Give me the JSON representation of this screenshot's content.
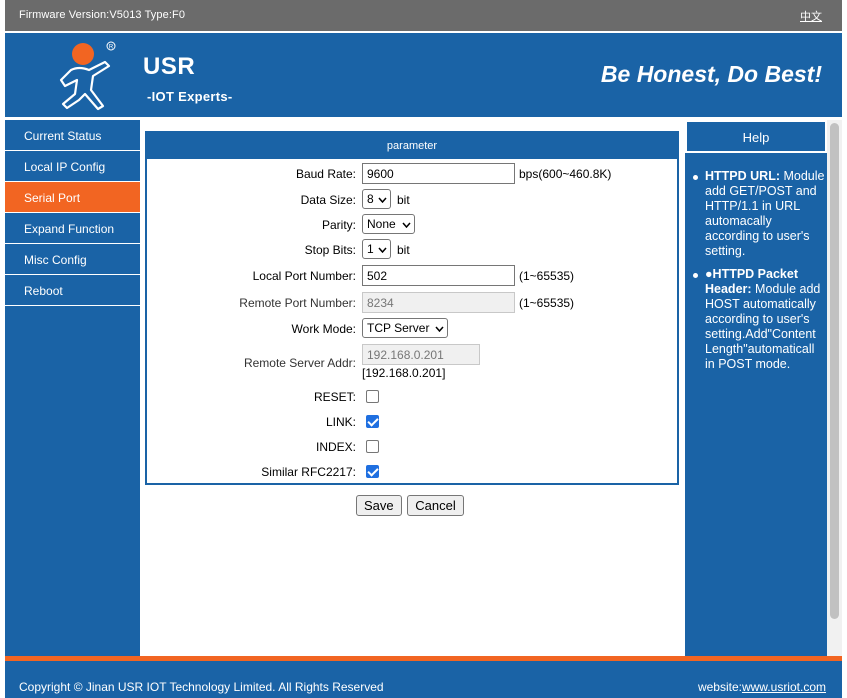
{
  "topbar": {
    "firmware": "Firmware Version:V5013 Type:F0",
    "lang_link": "中文"
  },
  "header": {
    "brand": "USR",
    "subbrand": "-IOT Experts-",
    "slogan": "Be Honest, Do Best!"
  },
  "nav": {
    "items": [
      {
        "label": "Current Status",
        "active": false
      },
      {
        "label": "Local IP Config",
        "active": false
      },
      {
        "label": "Serial Port",
        "active": true
      },
      {
        "label": "Expand Function",
        "active": false
      },
      {
        "label": "Misc Config",
        "active": false
      },
      {
        "label": "Reboot",
        "active": false
      }
    ]
  },
  "panel": {
    "title": "parameter",
    "baud_rate": {
      "label": "Baud Rate:",
      "value": "9600",
      "unit": "bps(600~460.8K)"
    },
    "data_size": {
      "label": "Data Size:",
      "value": "8",
      "unit": "bit"
    },
    "parity": {
      "label": "Parity:",
      "value": "None"
    },
    "stop_bits": {
      "label": "Stop Bits:",
      "value": "1",
      "unit": "bit"
    },
    "local_port": {
      "label": "Local Port Number:",
      "value": "502",
      "unit": "(1~65535)"
    },
    "remote_port": {
      "label": "Remote Port Number:",
      "value": "8234",
      "unit": "(1~65535)"
    },
    "work_mode": {
      "label": "Work Mode:",
      "value": "TCP Server"
    },
    "remote_server": {
      "label": "Remote Server Addr:",
      "value": "192.168.0.201",
      "hint": "[192.168.0.201]"
    },
    "reset": {
      "label": "RESET:",
      "checked": false
    },
    "link": {
      "label": "LINK:",
      "checked": true
    },
    "index": {
      "label": "INDEX:",
      "checked": false
    },
    "rfc2217": {
      "label": "Similar RFC2217:",
      "checked": true
    }
  },
  "buttons": {
    "save": "Save",
    "cancel": "Cancel"
  },
  "help": {
    "title": "Help",
    "items": [
      {
        "heading": "HTTPD URL:",
        "text": "Module add GET/POST and HTTP/1.1 in URL automacally according to user's setting."
      },
      {
        "heading": "●HTTPD Packet Header:",
        "text": "Module add HOST automatically according to user's setting.Add\"Content Length\"automaticall in POST mode."
      }
    ]
  },
  "footer": {
    "copyright": "Copyright © Jinan USR IOT Technology Limited. All Rights Reserved",
    "website_label": "website:",
    "website": "www.usriot.com"
  },
  "colors": {
    "primary": "#1a63a6",
    "accent": "#f26522",
    "topbar": "#6b6b6b"
  }
}
